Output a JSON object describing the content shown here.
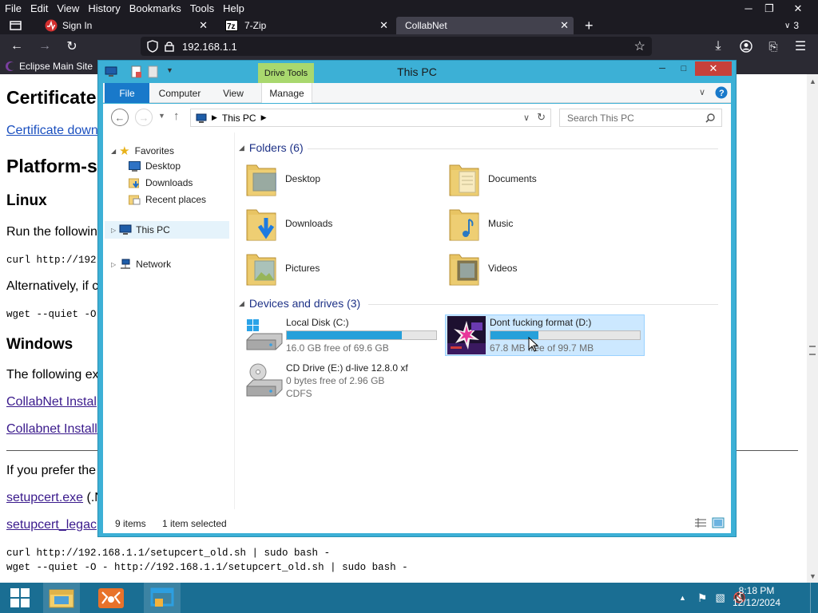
{
  "firefox": {
    "menu": [
      "File",
      "Edit",
      "View",
      "History",
      "Bookmarks",
      "Tools",
      "Help"
    ],
    "tabs": [
      {
        "label": "Sign In",
        "active": false
      },
      {
        "label": "7-Zip",
        "active": false
      },
      {
        "label": "CollabNet",
        "active": true
      }
    ],
    "tab_overflow_count": "3",
    "url": "192.168.1.1",
    "bookmarks": [
      "Eclipse Main Site"
    ]
  },
  "page": {
    "heading_certificate": "Certificate",
    "link_certificate_download": "Certificate down",
    "heading_platform": "Platform-s",
    "heading_linux": "Linux",
    "linux_text": "Run the followin",
    "linux_code1": "curl http://192.",
    "alt_text": "Alternatively, if c",
    "linux_code2": "wget --quiet -O",
    "heading_windows": "Windows",
    "windows_text": "The following ex",
    "link_collabnet1": "CollabNet Instal",
    "link_collabnet2": "Collabnet Install",
    "prefer_text": "If you prefer the",
    "link_setupcert": "setupcert.exe",
    "setupcert_suffix": " (.N",
    "link_setupcert_legacy": "setupcert_legac",
    "code_old1": "curl http://192.168.1.1/setupcert_old.sh | sudo bash -",
    "code_old2": "wget --quiet -O - http://192.168.1.1/setupcert_old.sh | sudo bash -"
  },
  "explorer": {
    "title": "This PC",
    "contextual_tab": "Drive Tools",
    "ribbon_tabs": [
      "File",
      "Computer",
      "View",
      "Manage"
    ],
    "address": "This PC",
    "search_placeholder": "Search This PC",
    "nav": {
      "favorites": "Favorites",
      "desktop": "Desktop",
      "downloads": "Downloads",
      "recent": "Recent places",
      "this_pc": "This PC",
      "network": "Network"
    },
    "folders_header": "Folders (6)",
    "folders": [
      "Desktop",
      "Documents",
      "Downloads",
      "Music",
      "Pictures",
      "Videos"
    ],
    "drives_header": "Devices and drives (3)",
    "drives": [
      {
        "name": "Local Disk (C:)",
        "free": "16.0 GB free of 69.6 GB",
        "used_fraction": 0.77
      },
      {
        "name": "Dont fucking format (D:)",
        "free": "67.8 MB free of 99.7 MB",
        "used_fraction": 0.32
      },
      {
        "name": "CD Drive (E:) d-live 12.8.0 xf",
        "free": "0 bytes free of 2.96 GB",
        "fs": "CDFS"
      }
    ],
    "status_items": "9 items",
    "status_selected": "1 item selected"
  },
  "taskbar": {
    "time": "8:18 PM",
    "date": "12/12/2024"
  },
  "colors": {
    "accent": "#1979ca",
    "drive_bar": "#26a0da",
    "taskbar": "#1a6e93",
    "window_frame": "#3cb0d6"
  }
}
